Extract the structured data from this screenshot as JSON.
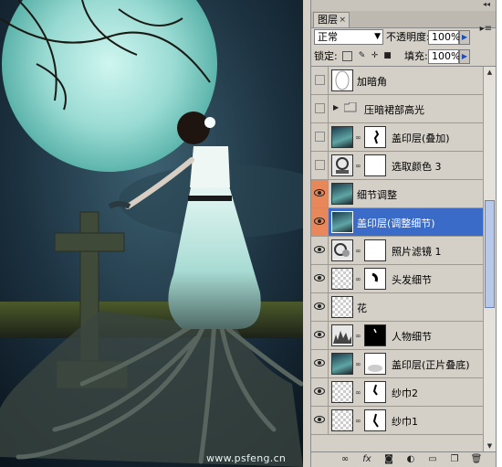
{
  "watermark": "www.psfeng.cn",
  "panel": {
    "tab_label": "图层",
    "collapse_glyph": "◂◂",
    "close_glyph": "×",
    "menu_glyph": "▸≡",
    "blend_mode": "正常",
    "opacity_label": "不透明度:",
    "opacity_value": "100%",
    "lock_label": "锁定:",
    "fill_label": "填充:",
    "fill_value": "100%"
  },
  "layers": [
    {
      "name": "加暗角",
      "visible": false,
      "thumb": "mask-oval",
      "mask": false,
      "selected": false
    },
    {
      "name": "压暗裙部高光",
      "visible": false,
      "thumb": "folder",
      "mask": false,
      "selected": false
    },
    {
      "name": "盖印层(叠加)",
      "visible": false,
      "thumb": "image",
      "mask": true,
      "selected": false
    },
    {
      "name": "选取颜色 3",
      "visible": false,
      "thumb": "adjustment",
      "mask": true,
      "selected": false
    },
    {
      "name": "细节调整",
      "visible": true,
      "thumb": "image",
      "mask": false,
      "selected": false
    },
    {
      "name": "盖印层(调整细节)",
      "visible": true,
      "thumb": "image",
      "mask": false,
      "selected": true
    },
    {
      "name": "照片滤镜 1",
      "visible": true,
      "thumb": "adjustment",
      "mask": true,
      "selected": false
    },
    {
      "name": "头发细节",
      "visible": true,
      "thumb": "checker",
      "mask": true,
      "selected": false
    },
    {
      "name": "花",
      "visible": true,
      "thumb": "checker",
      "mask": false,
      "selected": false
    },
    {
      "name": "人物细节",
      "visible": true,
      "thumb": "levels",
      "mask": true,
      "selected": false
    },
    {
      "name": "盖印层(正片叠底)",
      "visible": true,
      "thumb": "image",
      "mask": true,
      "selected": false
    },
    {
      "name": "纱巾2",
      "visible": true,
      "thumb": "checker",
      "mask": true,
      "selected": false
    },
    {
      "name": "纱巾1",
      "visible": true,
      "thumb": "checker",
      "mask": true,
      "selected": false
    }
  ],
  "colors": {
    "selection": "#3a6bc9",
    "highlight_eye": "#e8875a",
    "panel_bg": "#d4d0c8"
  }
}
